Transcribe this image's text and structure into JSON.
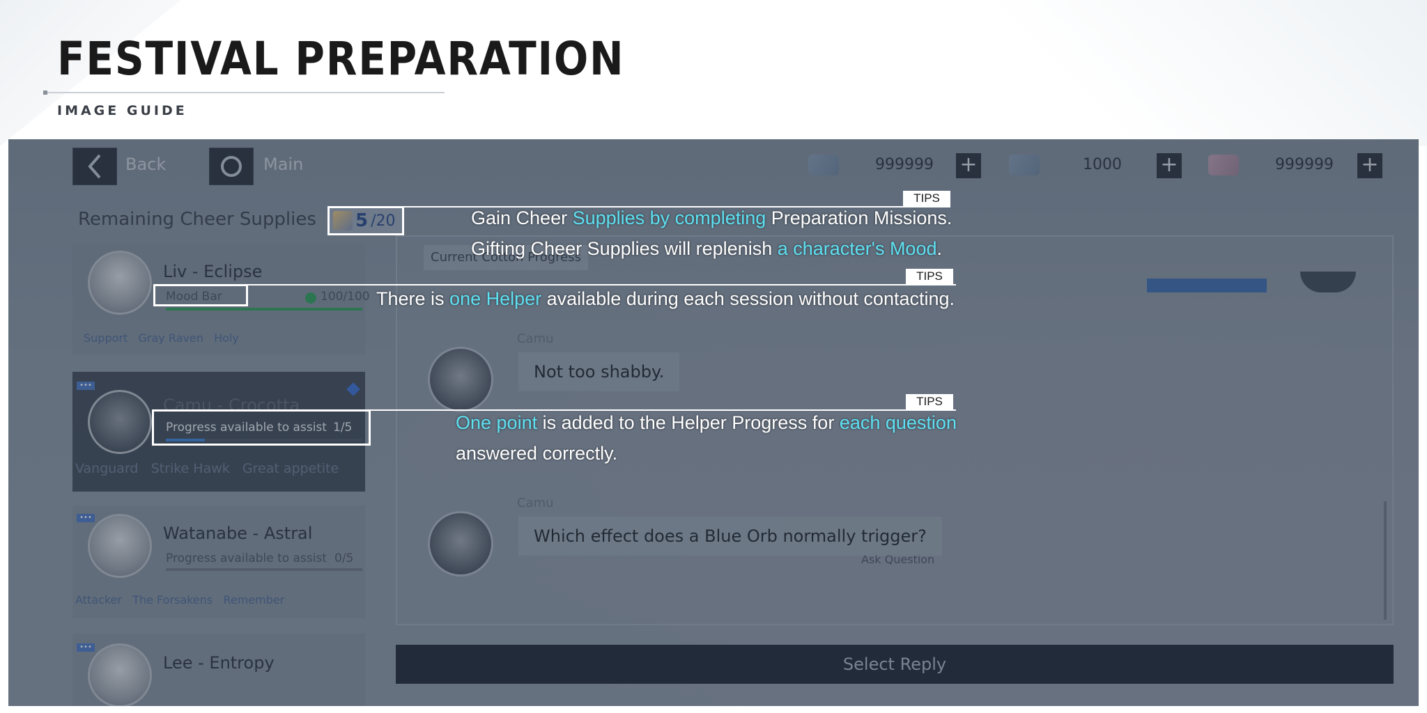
{
  "header": {
    "title": "FESTIVAL PREPARATION",
    "subtitle": "IMAGE GUIDE"
  },
  "topbar": {
    "back_label": "Back",
    "main_label": "Main",
    "currencies": [
      {
        "icon": "gear-token-icon",
        "value": "999999"
      },
      {
        "icon": "blue-ticket-icon",
        "value": "1000"
      },
      {
        "icon": "pink-ticket-icon",
        "value": "999999"
      }
    ],
    "plus_glyph": "+"
  },
  "supplies": {
    "label": "Remaining Cheer Supplies",
    "current": "5",
    "max": "/20"
  },
  "characters": [
    {
      "name": "Liv - Eclipse",
      "bar_label": "Mood Bar",
      "bar_value": "100/100",
      "tags": [
        "Support",
        "Gray Raven",
        "Holy"
      ]
    },
    {
      "name": "Camu - Crocotta",
      "bar_label": "Progress available to assist",
      "bar_value": "1/5",
      "tags": [
        "Vanguard",
        "Strike Hawk",
        "Great appetite"
      ],
      "badge": "•••"
    },
    {
      "name": "Watanabe - Astral",
      "bar_label": "Progress available to assist",
      "bar_value": "0/5",
      "tags": [
        "Attacker",
        "The Forsakens",
        "Remember"
      ],
      "badge": "•••"
    },
    {
      "name": "Lee - Entropy",
      "badge": "•••"
    }
  ],
  "panel": {
    "progress_tab": "Current Cotton Progress",
    "messages": [
      {
        "speaker": "Camu",
        "text": "Not too shabby."
      },
      {
        "speaker": "Camu",
        "text": "Which effect does a Blue Orb normally trigger?"
      }
    ],
    "ask_label": "Ask Question",
    "reply_button": "Select Reply"
  },
  "tips": {
    "tag": "TIPS",
    "tip1_line1": [
      "Gain Cheer ",
      "Supplies by completing",
      " Preparation Missions."
    ],
    "tip1_line2": [
      "Gifting Cheer Supplies will replenish ",
      "a character's Mood",
      "."
    ],
    "tip2": [
      "There is ",
      "one Helper",
      " available during each session without contacting."
    ],
    "tip3_line1": [
      "One point",
      " is added to the Helper Progress for ",
      "each question"
    ],
    "tip3_line2": "answered correctly."
  },
  "colors": {
    "highlight": "#5ee1f2",
    "progress_fill": "#3b82d6",
    "mood_fill": "#2e9e5b"
  },
  "bars": {
    "liv_mood_fraction": 1.0,
    "camu_progress_fraction": 0.2,
    "watanabe_progress_fraction": 0.0
  }
}
